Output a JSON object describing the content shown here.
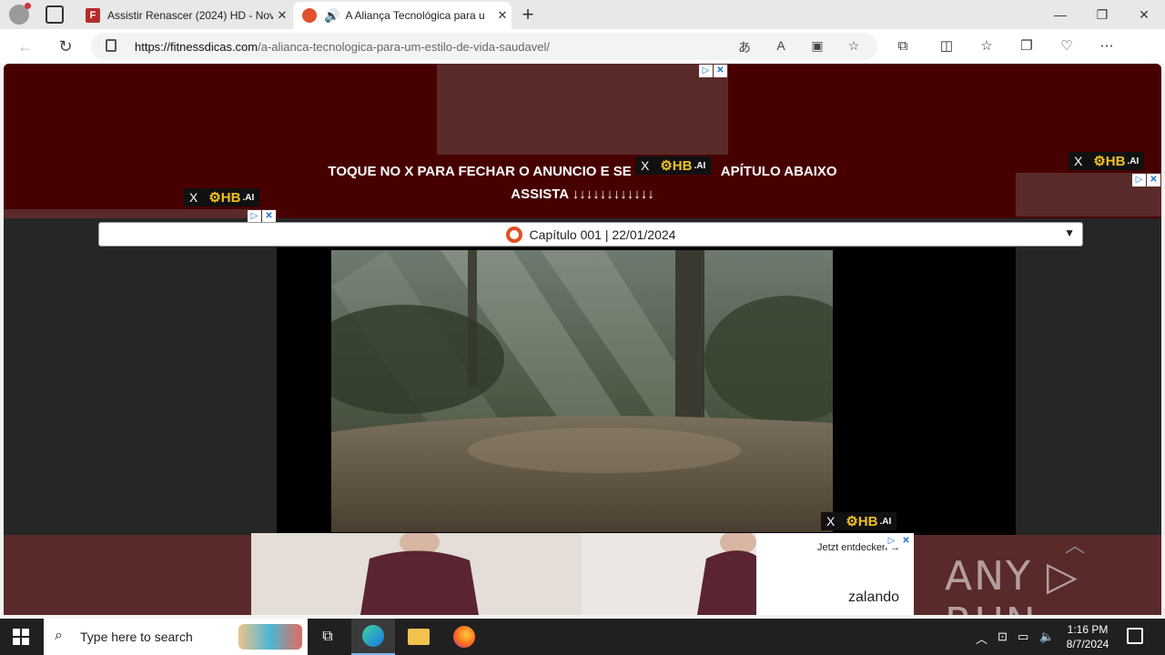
{
  "browser": {
    "tabs": [
      {
        "title": "Assistir Renascer (2024) HD - Nov",
        "favicon": "F"
      },
      {
        "title": "A Aliança Tecnológica para u",
        "active": true
      }
    ],
    "url_host": "https://fitnessdicas.com",
    "url_path": "/a-alianca-tecnologica-para-um-estilo-de-vida-saudavel/"
  },
  "page": {
    "notice_line1": "TOQUE NO X PARA FECHAR O ANUNCIO E SE",
    "notice_line1_end": "APÍTULO ABAIXO",
    "notice_line2": "ASSISTA ↓↓↓↓↓↓↓↓↓↓↓↓",
    "hb_close": "X",
    "hb_logo": "⚙HB",
    "hb_suffix": ".AI",
    "chapter": "Capítulo 001 | 22/01/2024",
    "ad_cta": "Jetzt entdecken →",
    "ad_brand": "zalando",
    "watermark": "ANY ▷ RUN"
  },
  "taskbar": {
    "search_placeholder": "Type here to search",
    "time": "1:16 PM",
    "date": "8/7/2024"
  },
  "colors": {
    "banner": "#470000",
    "ad_band": "#5a2a2a"
  }
}
